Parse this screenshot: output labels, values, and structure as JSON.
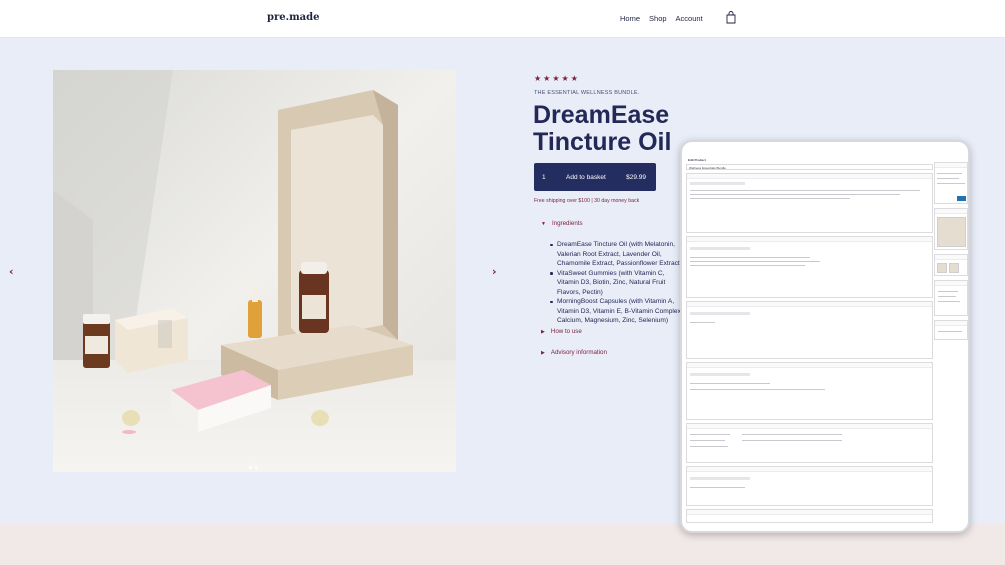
{
  "header": {
    "logo": "pre.made",
    "nav": [
      {
        "label": "Home"
      },
      {
        "label": "Shop"
      },
      {
        "label": "Account"
      }
    ]
  },
  "gallery": {
    "prev_arrow": "‹",
    "next_arrow": "›",
    "slides": 2,
    "active_slide": 1
  },
  "product": {
    "rating_stars": "★★★★★",
    "rating": 5,
    "kicker": "THE ESSENTIAL WELLNESS BUNDLE.",
    "title": "DreamEase Tincture Oil",
    "quantity": "1",
    "add_to_basket": "Add to basket",
    "price": "$29.99",
    "shipping_note": "Free shipping over $100 | 30 day money back",
    "accordion": {
      "ingredients": "Ingredients",
      "how_to_use": "How to use",
      "advisory": "Advisory information"
    },
    "ingredients": [
      "DreamEase Tincture Oil (with Melatonin, Valerian Root Extract, Lavender Oil, Chamomile Extract, Passionflower Extract)",
      "VitaSweet Gummies (with Vitamin C, Vitamin D3, Biotin, Zinc, Natural Fruit Flavors, Pectin)",
      "MorningBoost Capsules (with Vitamin A, Vitamin D3, Vitamin E, B-Vitamin Complex, Calcium, Magnesium, Zinc, Selenium)"
    ]
  },
  "colors": {
    "accent": "#7a1f3d",
    "navy": "#242d5f",
    "page_bg": "#e9edf7",
    "footer_bg": "#f1e8e8"
  },
  "admin_preview": {
    "screen_title": "Edit Product",
    "product_name": "Wellness Essentials Bundle"
  }
}
